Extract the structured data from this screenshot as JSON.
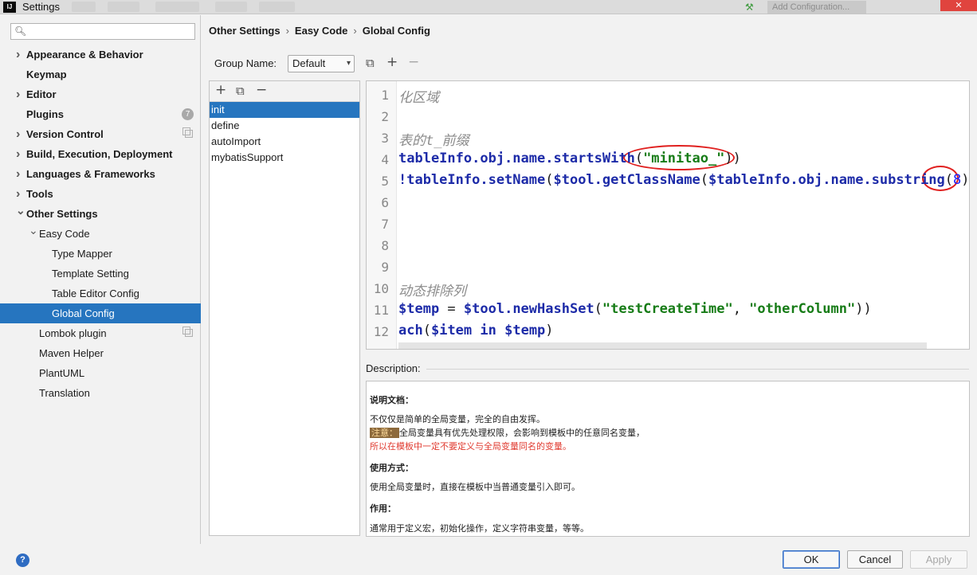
{
  "window": {
    "logo": "IJ",
    "title": "Settings",
    "add_configuration": "Add Configuration...",
    "close_glyph": "✕"
  },
  "sidebar": {
    "search_placeholder": "",
    "items": [
      {
        "label": "Appearance & Behavior",
        "level": 0,
        "bold": true,
        "arrow": "right"
      },
      {
        "label": "Keymap",
        "level": 0,
        "bold": true,
        "arrow": "none"
      },
      {
        "label": "Editor",
        "level": 0,
        "bold": true,
        "arrow": "right"
      },
      {
        "label": "Plugins",
        "level": 0,
        "bold": true,
        "arrow": "none",
        "badge": "7"
      },
      {
        "label": "Version Control",
        "level": 0,
        "bold": true,
        "arrow": "right",
        "copy": true
      },
      {
        "label": "Build, Execution, Deployment",
        "level": 0,
        "bold": true,
        "arrow": "right"
      },
      {
        "label": "Languages & Frameworks",
        "level": 0,
        "bold": true,
        "arrow": "right"
      },
      {
        "label": "Tools",
        "level": 0,
        "bold": true,
        "arrow": "right"
      },
      {
        "label": "Other Settings",
        "level": 0,
        "bold": true,
        "arrow": "down"
      },
      {
        "label": "Easy Code",
        "level": 1,
        "bold": false,
        "arrow": "down"
      },
      {
        "label": "Type Mapper",
        "level": 2,
        "bold": false,
        "arrow": "none"
      },
      {
        "label": "Template Setting",
        "level": 2,
        "bold": false,
        "arrow": "none"
      },
      {
        "label": "Table Editor Config",
        "level": 2,
        "bold": false,
        "arrow": "none"
      },
      {
        "label": "Global Config",
        "level": 2,
        "bold": false,
        "arrow": "none",
        "selected": true
      },
      {
        "label": "Lombok plugin",
        "level": 1,
        "bold": false,
        "arrow": "none",
        "copy": true
      },
      {
        "label": "Maven Helper",
        "level": 1,
        "bold": false,
        "arrow": "none"
      },
      {
        "label": "PlantUML",
        "level": 1,
        "bold": false,
        "arrow": "none"
      },
      {
        "label": "Translation",
        "level": 1,
        "bold": false,
        "arrow": "none"
      }
    ]
  },
  "breadcrumb": [
    "Other Settings",
    "Easy Code",
    "Global Config"
  ],
  "group": {
    "label": "Group Name:",
    "value": "Default"
  },
  "templates": {
    "items": [
      "init",
      "define",
      "autoImport",
      "mybatisSupport"
    ],
    "selected": "init"
  },
  "editor": {
    "lines": [
      {
        "n": "1",
        "segments": [
          {
            "t": "化区域",
            "c": "comment"
          }
        ]
      },
      {
        "n": "2",
        "segments": []
      },
      {
        "n": "3",
        "segments": [
          {
            "t": "表的t_前缀",
            "c": "comment"
          }
        ]
      },
      {
        "n": "4",
        "segments": [
          {
            "t": "tableInfo.obj.name.startsWith",
            "c": "var"
          },
          {
            "t": "(",
            "c": "plain"
          },
          {
            "t": "\"minitao_\"",
            "c": "str"
          },
          {
            "t": "))",
            "c": "plain"
          }
        ]
      },
      {
        "n": "5",
        "segments": [
          {
            "t": "!tableInfo.setName",
            "c": "var"
          },
          {
            "t": "(",
            "c": "plain"
          },
          {
            "t": "$tool.getClassName",
            "c": "var"
          },
          {
            "t": "(",
            "c": "plain"
          },
          {
            "t": "$tableInfo.obj.name.substring",
            "c": "var"
          },
          {
            "t": "(",
            "c": "plain"
          },
          {
            "t": "8",
            "c": "num"
          },
          {
            "t": ")))",
            "c": "plain"
          }
        ]
      },
      {
        "n": "6",
        "segments": []
      },
      {
        "n": "7",
        "segments": []
      },
      {
        "n": "8",
        "segments": []
      },
      {
        "n": "9",
        "segments": []
      },
      {
        "n": "10",
        "segments": [
          {
            "t": "动态排除列",
            "c": "comment"
          }
        ]
      },
      {
        "n": "11",
        "segments": [
          {
            "t": "$temp",
            "c": "var"
          },
          {
            "t": " = ",
            "c": "plain"
          },
          {
            "t": "$tool.newHashSet",
            "c": "var"
          },
          {
            "t": "(",
            "c": "plain"
          },
          {
            "t": "\"testCreateTime\"",
            "c": "str"
          },
          {
            "t": ", ",
            "c": "plain"
          },
          {
            "t": "\"otherColumn\"",
            "c": "str"
          },
          {
            "t": "))",
            "c": "plain"
          }
        ]
      },
      {
        "n": "12",
        "segments": [
          {
            "t": "ach",
            "c": "var"
          },
          {
            "t": "(",
            "c": "plain"
          },
          {
            "t": "$item",
            "c": "var"
          },
          {
            "t": " in ",
            "c": "var"
          },
          {
            "t": "$temp",
            "c": "var"
          },
          {
            "t": ")",
            "c": "plain"
          }
        ]
      }
    ]
  },
  "description": {
    "label": "Description:",
    "doc_title": "说明文档：",
    "line1": "不仅仅是简单的全局变量，完全的自由发挥。",
    "note_tag": "注意：",
    "line2": "全局变量具有优先处理权限，会影响到模板中的任意同名变量，",
    "line3": "所以在模板中一定不要定义与全局变量同名的变量。",
    "usage_title": "使用方式：",
    "usage_text": "使用全局变量时，直接在模板中当普通变量引入即可。",
    "purpose_title": "作用：",
    "purpose_text": "通常用于定义宏，初始化操作，定义字符串变量，等等。"
  },
  "buttons": {
    "help": "?",
    "ok": "OK",
    "cancel": "Cancel",
    "apply": "Apply"
  },
  "colors": {
    "selection": "#2675bf",
    "annotation_circle": "#e0201f",
    "string": "#177c17",
    "variable": "#1d2ba8"
  }
}
